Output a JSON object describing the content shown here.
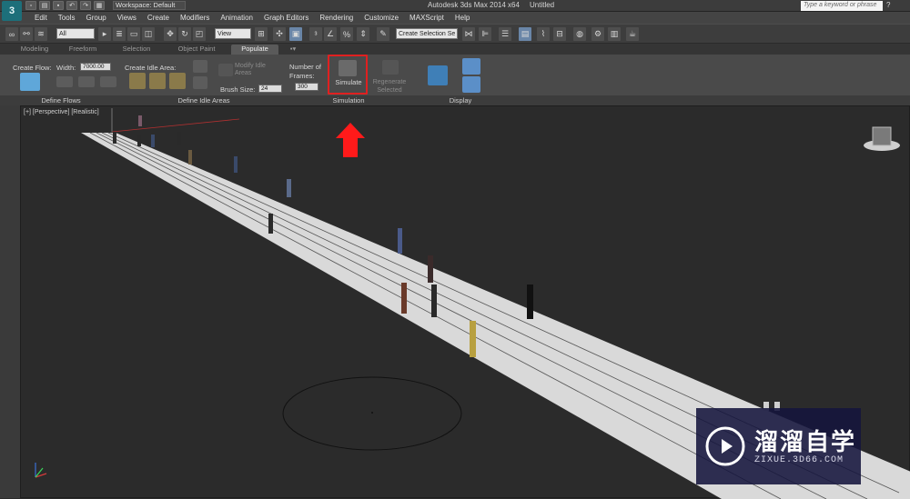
{
  "app": {
    "logo_glyph": "3",
    "title": "Autodesk 3ds Max  2014 x64",
    "document": "Untitled",
    "workspace_label": "Workspace: Default",
    "search_placeholder": "Type a keyword or phrase",
    "help_glyph": "?"
  },
  "menu": [
    "Edit",
    "Tools",
    "Group",
    "Views",
    "Create",
    "Modifiers",
    "Animation",
    "Graph Editors",
    "Rendering",
    "Customize",
    "MAXScript",
    "Help"
  ],
  "toolbar": {
    "filter_value": "All",
    "refcoord_value": "View",
    "selection_set_placeholder": "Create Selection Se"
  },
  "ribbon_tabs": [
    "Modeling",
    "Freeform",
    "Selection",
    "Object Paint",
    "Populate"
  ],
  "active_tab": "Populate",
  "ribbon": {
    "create_flow_label": "Create Flow:",
    "width_label": "Width:",
    "width_value": "7000.00",
    "create_idle_area_label": "Create Idle Area:",
    "modify_idle_areas_label": "Modify Idle Areas",
    "brush_size_label": "Brush Size:",
    "brush_size_value": "24",
    "number_of_frames_label": "Number of Frames:",
    "frames_value": "300",
    "simulate_label": "Simulate",
    "regenerate_label": "Regenerate Selected"
  },
  "groups": [
    "Define Flows",
    "Define Idle Areas",
    "Simulation",
    "Display"
  ],
  "viewport": {
    "label": "[+] [Perspective] [Realistic]"
  },
  "watermark": {
    "main": "溜溜自学",
    "sub": "ZIXUE.3D66.COM"
  },
  "colors": {
    "highlight": "#e02020",
    "arrow": "#ff1a1a",
    "road": "#d9d9d9"
  }
}
